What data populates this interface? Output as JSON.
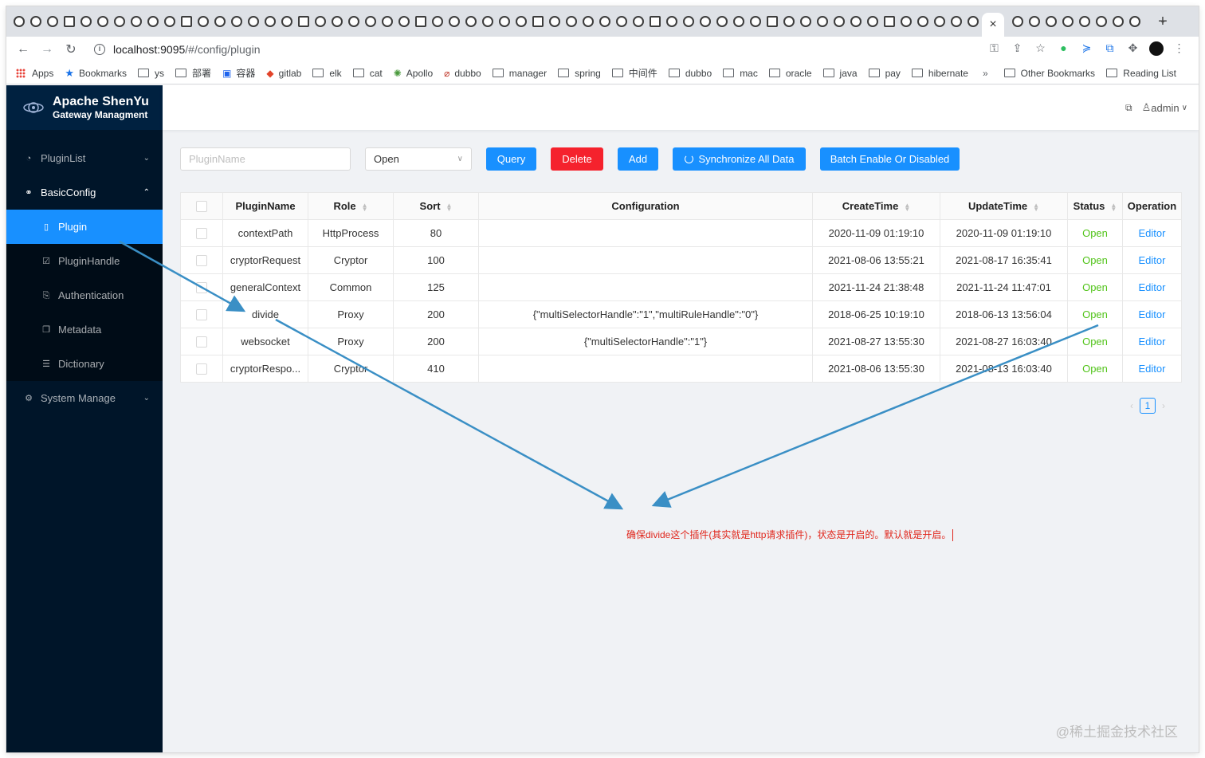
{
  "browser": {
    "tab_close": "×",
    "new_tab": "+",
    "tab_menu": "⌄",
    "address": {
      "host": "localhost:9095",
      "path": "/#/config/plugin"
    },
    "bookmarks": [
      {
        "label": "Apps",
        "icon": "apps-grid-icon"
      },
      {
        "label": "Bookmarks",
        "icon": "star-icon"
      },
      {
        "label": "ys",
        "icon": "folder-icon"
      },
      {
        "label": "部署",
        "icon": "folder-icon"
      },
      {
        "label": "容器",
        "icon": "docker-icon"
      },
      {
        "label": "gitlab",
        "icon": "gitlab-icon"
      },
      {
        "label": "elk",
        "icon": "folder-icon"
      },
      {
        "label": "cat",
        "icon": "folder-icon"
      },
      {
        "label": "Apollo",
        "icon": "apollo-icon"
      },
      {
        "label": "dubbo",
        "icon": "dubbo-icon"
      },
      {
        "label": "manager",
        "icon": "folder-icon"
      },
      {
        "label": "spring",
        "icon": "folder-icon"
      },
      {
        "label": "中间件",
        "icon": "folder-icon"
      },
      {
        "label": "dubbo",
        "icon": "folder-icon"
      },
      {
        "label": "mac",
        "icon": "folder-icon"
      },
      {
        "label": "oracle",
        "icon": "folder-icon"
      },
      {
        "label": "java",
        "icon": "folder-icon"
      },
      {
        "label": "pay",
        "icon": "folder-icon"
      },
      {
        "label": "hibernate",
        "icon": "folder-icon"
      }
    ],
    "bookmarks_more": "»",
    "other_bookmarks": "Other Bookmarks",
    "reading_list": "Reading List"
  },
  "sider": {
    "title": "Apache ShenYu",
    "subtitle": "Gateway Managment",
    "menu": [
      {
        "label": "PluginList",
        "icon": "gauge-icon",
        "type": "top",
        "arrow": "⌄"
      },
      {
        "label": "BasicConfig",
        "icon": "link-icon",
        "type": "top-open",
        "arrow": "⌃"
      },
      {
        "label": "Plugin",
        "icon": "file-icon",
        "type": "selected"
      },
      {
        "label": "PluginHandle",
        "icon": "check-square-icon",
        "type": "sub"
      },
      {
        "label": "Authentication",
        "icon": "audit-icon",
        "type": "sub"
      },
      {
        "label": "Metadata",
        "icon": "copy-icon",
        "type": "sub"
      },
      {
        "label": "Dictionary",
        "icon": "list-icon",
        "type": "sub"
      },
      {
        "label": "System Manage",
        "icon": "setting-icon",
        "type": "top",
        "arrow": "⌄"
      }
    ]
  },
  "header": {
    "user": "admin"
  },
  "filters": {
    "name_placeholder": "PluginName",
    "status_value": "Open"
  },
  "buttons": {
    "query": "Query",
    "delete": "Delete",
    "add": "Add",
    "sync": "Synchronize All Data",
    "batch": "Batch Enable Or Disabled"
  },
  "table": {
    "columns": [
      "PluginName",
      "Role",
      "Sort",
      "Configuration",
      "CreateTime",
      "UpdateTime",
      "Status",
      "Operation"
    ],
    "rows": [
      {
        "name": "contextPath",
        "role": "HttpProcess",
        "sort": "80",
        "config": "",
        "create": "2020-11-09 01:19:10",
        "update": "2020-11-09 01:19:10",
        "status": "Open",
        "op": "Editor"
      },
      {
        "name": "cryptorRequest",
        "role": "Cryptor",
        "sort": "100",
        "config": "",
        "create": "2021-08-06 13:55:21",
        "update": "2021-08-17 16:35:41",
        "status": "Open",
        "op": "Editor"
      },
      {
        "name": "generalContext",
        "role": "Common",
        "sort": "125",
        "config": "",
        "create": "2021-11-24 21:38:48",
        "update": "2021-11-24 11:47:01",
        "status": "Open",
        "op": "Editor"
      },
      {
        "name": "divide",
        "role": "Proxy",
        "sort": "200",
        "config": "{\"multiSelectorHandle\":\"1\",\"multiRuleHandle\":\"0\"}",
        "create": "2018-06-25 10:19:10",
        "update": "2018-06-13 13:56:04",
        "status": "Open",
        "op": "Editor"
      },
      {
        "name": "websocket",
        "role": "Proxy",
        "sort": "200",
        "config": "{\"multiSelectorHandle\":\"1\"}",
        "create": "2021-08-27 13:55:30",
        "update": "2021-08-27 16:03:40",
        "status": "Open",
        "op": "Editor"
      },
      {
        "name": "cryptorRespo...",
        "role": "Cryptor",
        "sort": "410",
        "config": "",
        "create": "2021-08-06 13:55:30",
        "update": "2021-08-13 16:03:40",
        "status": "Open",
        "op": "Editor"
      }
    ]
  },
  "pagination": {
    "prev": "‹",
    "current": "1",
    "next": "›"
  },
  "annotation": {
    "note": "确保divide这个插件(其实就是http请求插件)，状态是开启的。默认就是开启。",
    "color": "#e0261c",
    "arrow_color": "#3a8fc5"
  },
  "watermark": "@稀土掘金技术社区"
}
